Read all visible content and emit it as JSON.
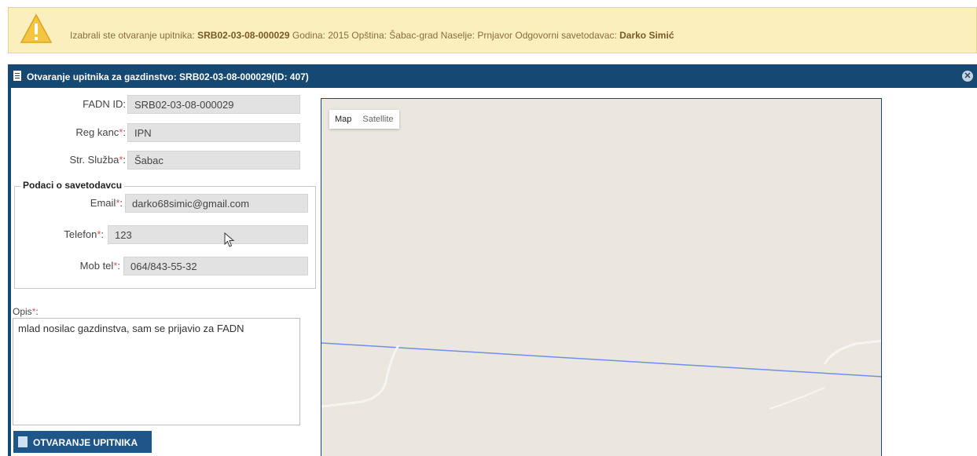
{
  "banner": {
    "prefix": "Izabrali ste otvaranje upitnika:",
    "code": "SRB02-03-08-000029",
    "details": "Godina: 2015 Opština: Šabac-grad Naselje: Prnjavor Odgovorni savetodavac:",
    "advisor": "Darko Simić",
    "icon": "warning-icon"
  },
  "dialog": {
    "title": "Otvaranje upitnika za gazdinstvo: SRB02-03-08-000029(ID: 407)",
    "close_symbol": "✕"
  },
  "form": {
    "fadn_label": "FADN ID:",
    "fadn_value": "SRB02-03-08-000029",
    "reg_label": "Reg kanc",
    "reg_value": "IPN",
    "sluzba_label": "Str. Služba",
    "sluzba_value": "Šabac",
    "required_mark": "*",
    "colon": ":"
  },
  "advisor_section": {
    "legend": "Podaci o savetodavcu",
    "email_label": "Email",
    "email_value": "darko68simic@gmail.com",
    "telefon_label": "Telefon",
    "telefon_value": "123",
    "mob_label": "Mob tel",
    "mob_value": "064/843-55-32"
  },
  "opis": {
    "label": "Opis",
    "value": "mlad nosilac gazdinstva, sam se prijavio za FADN"
  },
  "button": {
    "label": "OTVARANJE UPITNIKA"
  },
  "map": {
    "tab_map": "Map",
    "tab_satellite": "Satellite"
  },
  "colors": {
    "header": "#154873",
    "banner_bg": "#fbefbd",
    "button": "#1f5689",
    "map_bg": "#ebe7df",
    "route": "#6f8fe8"
  }
}
